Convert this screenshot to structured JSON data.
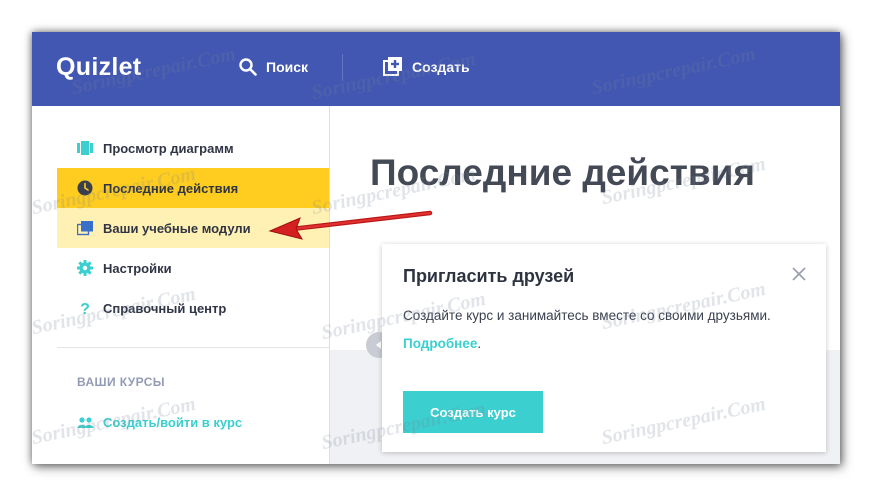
{
  "header": {
    "logo": "Quizlet",
    "search_label": "Поиск",
    "create_label": "Создать"
  },
  "sidebar": {
    "items": [
      {
        "label": "Просмотр диаграмм",
        "icon": "diagram-icon",
        "state": "normal"
      },
      {
        "label": "Последние действия",
        "icon": "clock-icon",
        "state": "active"
      },
      {
        "label": "Ваши учебные модули",
        "icon": "modules-icon",
        "state": "highlighted"
      },
      {
        "label": "Настройки",
        "icon": "gear-icon",
        "state": "normal"
      },
      {
        "label": "Справочный центр",
        "icon": "help-icon",
        "state": "normal"
      }
    ],
    "section_title": "ВАШИ КУРСЫ",
    "join_course_label": "Создать/войти в курс"
  },
  "main": {
    "title": "Последние действия"
  },
  "invite_card": {
    "title": "Пригласить друзей",
    "text": "Создайте курс и занимайтесь вместе со своими друзьями.",
    "link": "Подробнее",
    "link_suffix": ".",
    "button_label": "Создать курс"
  },
  "watermark": "Soringpcrepair.Com",
  "colors": {
    "header_bg": "#4257b2",
    "active_item": "#ffcd1f",
    "highlight_item": "#fff1b3",
    "accent_teal": "#3ccfcf",
    "annotation_arrow": "#d42020"
  }
}
